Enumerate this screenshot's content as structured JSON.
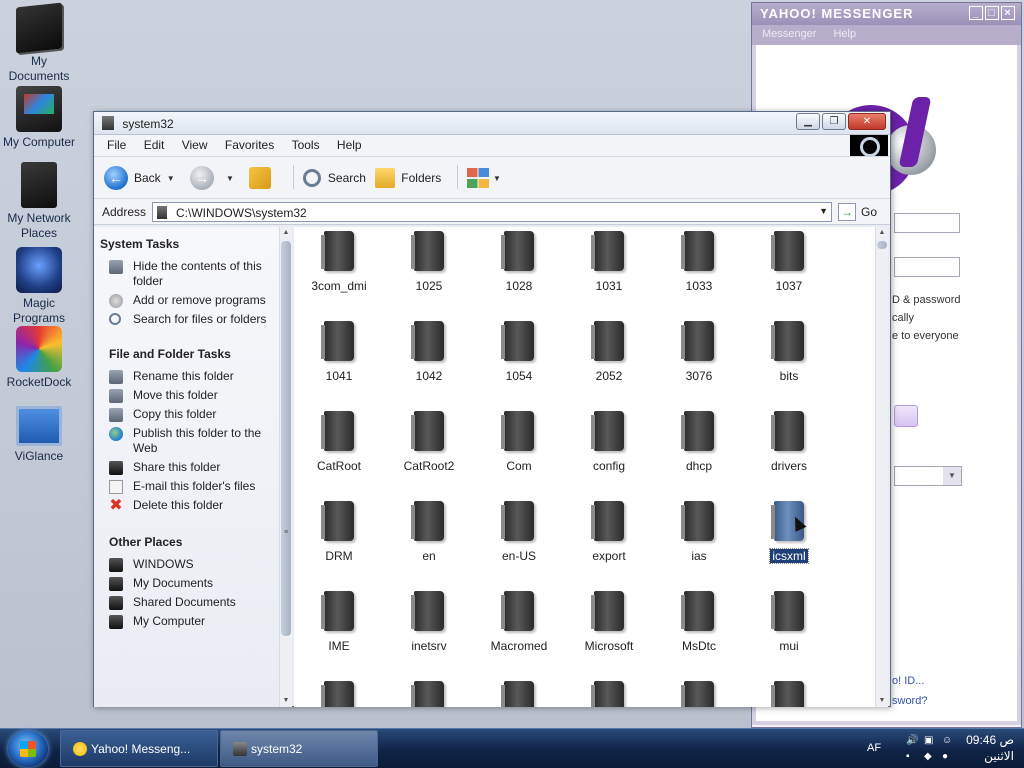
{
  "desktop": {
    "icons": [
      {
        "label": "My Documents",
        "icon": "documents-icon"
      },
      {
        "label": "My Computer",
        "icon": "computer-icon"
      },
      {
        "label": "My Network Places",
        "icon": "network-icon"
      },
      {
        "label": "Magic Programs",
        "icon": "magic-programs-icon"
      },
      {
        "label": "RocketDock",
        "icon": "rocketdock-icon"
      },
      {
        "label": "ViGlance",
        "icon": "viglance-icon"
      }
    ]
  },
  "messenger": {
    "title": "YAHOO! MESSENGER",
    "menu": [
      "Messenger",
      "Help"
    ],
    "texts": [
      "D & password",
      "cally",
      "e to everyone"
    ],
    "links": [
      "o! ID...",
      "sword?"
    ],
    "colors": {
      "brand": "#6b21a8"
    }
  },
  "explorer": {
    "title": "system32",
    "menu": [
      "File",
      "Edit",
      "View",
      "Favorites",
      "Tools",
      "Help"
    ],
    "toolbar": {
      "back": "Back",
      "search": "Search",
      "folders": "Folders"
    },
    "address": {
      "label": "Address",
      "value": "C:\\WINDOWS\\system32",
      "go": "Go"
    },
    "task_pane": {
      "system_tasks": {
        "title": "System Tasks",
        "items": [
          "Hide the contents of this folder",
          "Add or remove programs",
          "Search for files or folders"
        ]
      },
      "file_folder_tasks": {
        "title": "File and Folder Tasks",
        "items": [
          "Rename this folder",
          "Move this folder",
          "Copy this folder",
          "Publish this folder to the Web",
          "Share this folder",
          "E-mail this folder's files",
          "Delete this folder"
        ]
      },
      "other_places": {
        "title": "Other Places",
        "items": [
          "WINDOWS",
          "My Documents",
          "Shared Documents",
          "My Computer"
        ]
      }
    },
    "folders": [
      "3com_dmi",
      "1025",
      "1028",
      "1031",
      "1033",
      "1037",
      "1041",
      "1042",
      "1054",
      "2052",
      "3076",
      "bits",
      "CatRoot",
      "CatRoot2",
      "Com",
      "config",
      "dhcp",
      "drivers",
      "DRM",
      "en",
      "en-US",
      "export",
      "ias",
      "icsxml",
      "IME",
      "inetsrv",
      "Macromed",
      "Microsoft",
      "MsDtc",
      "mui"
    ],
    "selected_folder": "icsxml"
  },
  "taskbar": {
    "buttons": [
      "Yahoo! Messeng...",
      "system32"
    ],
    "active_button": "system32",
    "language": "AF",
    "clock_time": "09:46 ص",
    "clock_day": "الاثنين"
  }
}
